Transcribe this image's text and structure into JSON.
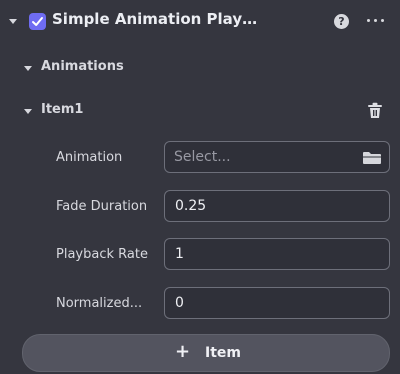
{
  "component": {
    "title": "Simple Animation Play…",
    "enabled": true,
    "help_icon": "help-circle-icon",
    "more_icon": "more-horizontal-icon"
  },
  "animations_section": {
    "label": "Animations"
  },
  "item": {
    "label": "Item1",
    "delete_icon": "trash-icon",
    "fields": {
      "animation": {
        "label": "Animation",
        "placeholder": "Select...",
        "icon": "folder-icon"
      },
      "fade_duration": {
        "label": "Fade Duration",
        "value": "0.25"
      },
      "playback_rate": {
        "label": "Playback Rate",
        "value": "1"
      },
      "normalized": {
        "label": "Normalized...",
        "value": "0"
      }
    }
  },
  "add_button": {
    "icon": "plus-icon",
    "label": "Item"
  },
  "colors": {
    "background": "#35363f",
    "accent": "#6f6cf2",
    "field_background": "#2f3039",
    "button_background": "#53545f"
  }
}
